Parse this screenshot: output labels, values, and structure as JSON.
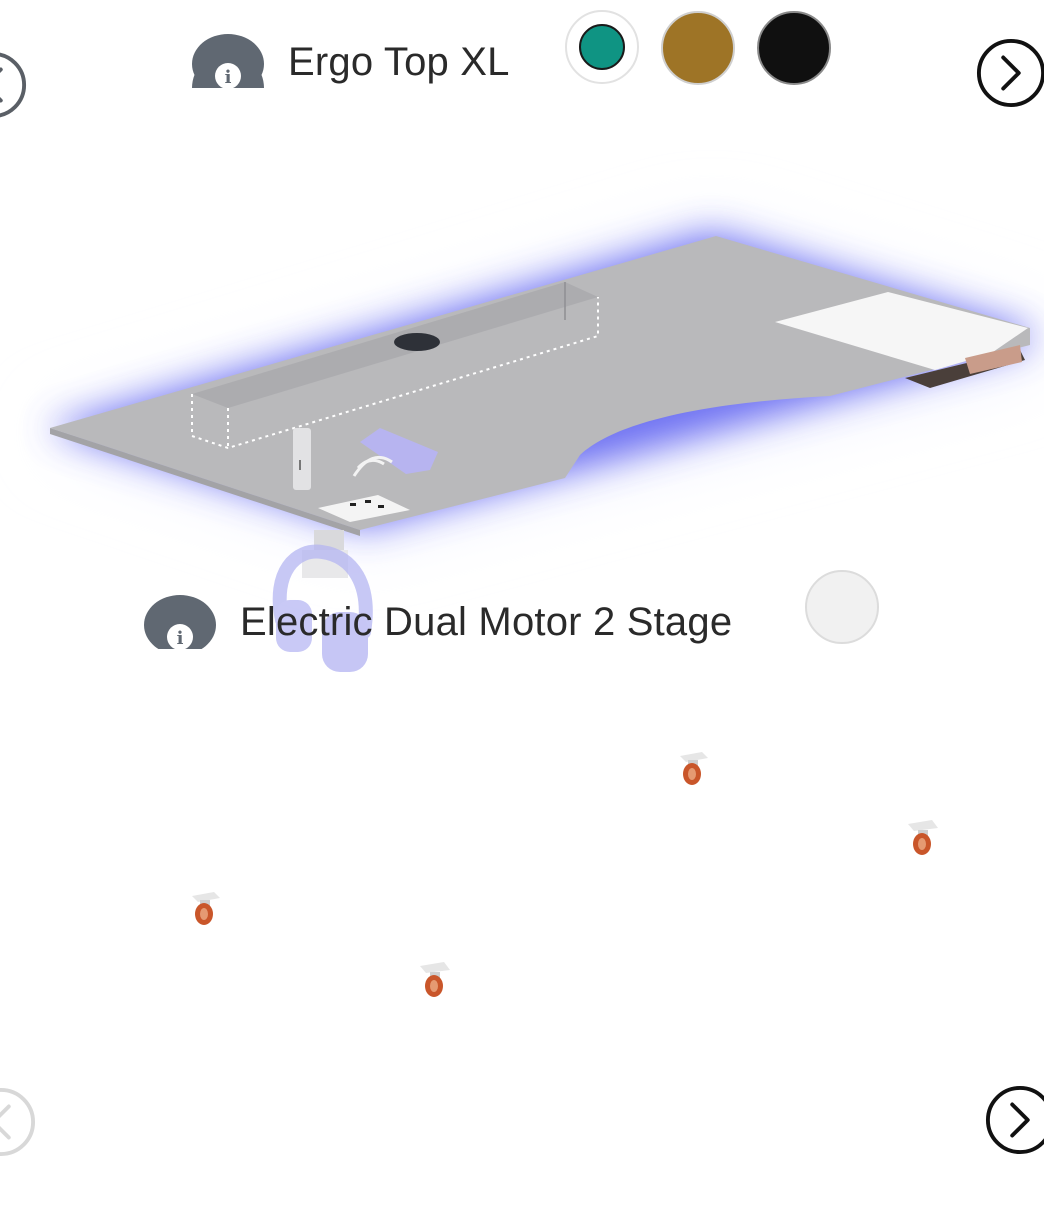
{
  "top": {
    "product_name": "Ergo Top XL",
    "info_icon": "info-icon",
    "prev_icon": "chevron-left-icon",
    "next_icon": "chevron-right-icon",
    "swatches": [
      {
        "name": "teal",
        "color": "#0f9483",
        "selected": true
      },
      {
        "name": "gold",
        "color": "#9e7426",
        "selected": false
      },
      {
        "name": "black",
        "color": "#101010",
        "selected": false
      }
    ]
  },
  "base": {
    "product_name": "Electric Dual Motor 2 Stage",
    "info_icon": "info-icon",
    "swatches": [
      {
        "name": "light-grey",
        "color": "#f1f1f1",
        "selected": false
      }
    ],
    "prev_icon": "chevron-left-icon",
    "next_icon": "chevron-right-icon"
  },
  "scene": {
    "desk_color": "#b9b9bb",
    "glow_color": "#5a5df0",
    "accessories": [
      "cable-tray-icon",
      "grommet-icon",
      "usb-stick-icon",
      "wireless-charger-icon",
      "power-socket-icon",
      "headphone-hook-icon",
      "headphones-icon",
      "drawer-icon",
      "caster-wheel-icon"
    ]
  }
}
